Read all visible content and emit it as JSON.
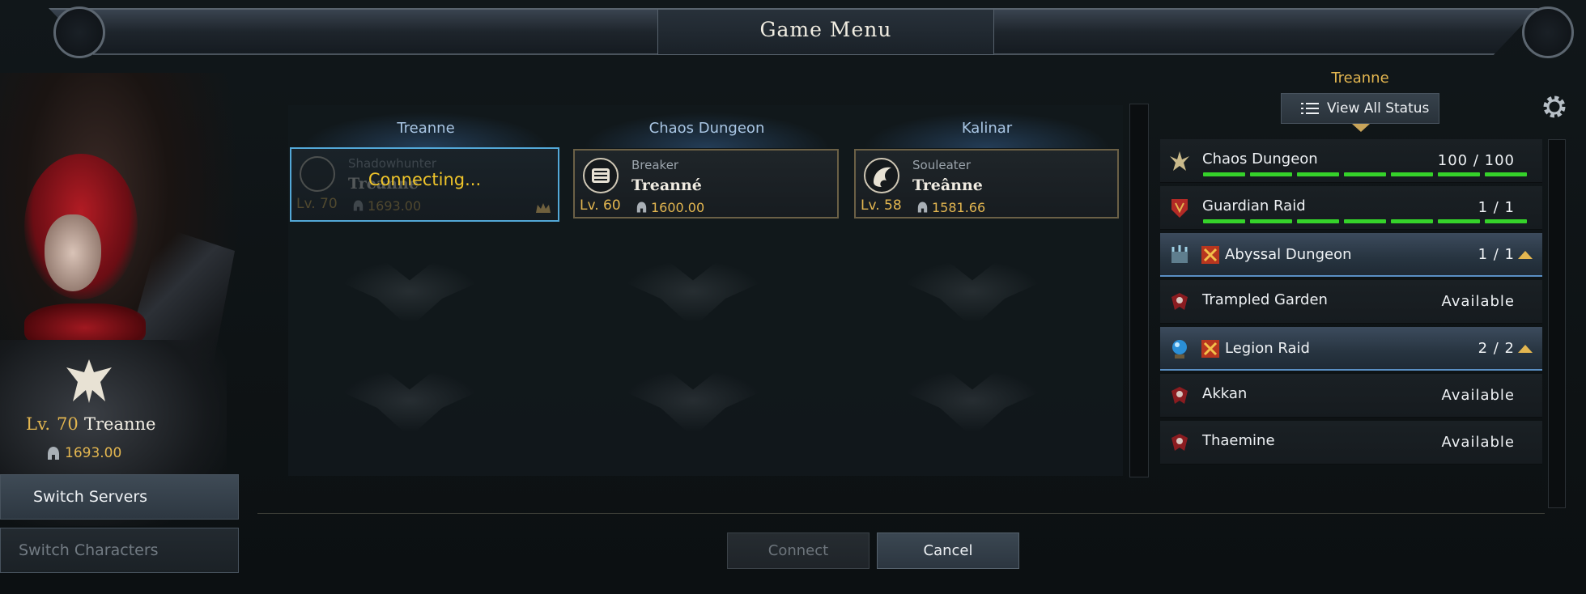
{
  "window": {
    "title": "Game Menu"
  },
  "character": {
    "level_label": "Lv.",
    "level": "70",
    "name": "Treanne",
    "item_level": "1693.00"
  },
  "side_buttons": {
    "switch_servers": "Switch Servers",
    "switch_characters": "Switch Characters"
  },
  "columns": [
    {
      "header": "Treanne"
    },
    {
      "header": "Chaos Dungeon"
    },
    {
      "header": "Kalinar"
    }
  ],
  "cards": [
    {
      "class": "Shadowhunter",
      "name": "Treanne",
      "level": "Lv. 70",
      "item_level": "1693.00",
      "status": "Connecting..."
    },
    {
      "class": "Breaker",
      "name": "Treanné",
      "level": "Lv. 60",
      "item_level": "1600.00"
    },
    {
      "class": "Souleater",
      "name": "Treânne",
      "level": "Lv. 58",
      "item_level": "1581.66"
    }
  ],
  "status_panel": {
    "character": "Treanne",
    "view_all_label": "View All Status",
    "rows": [
      {
        "label": "Chaos Dungeon",
        "value": "100 / 100",
        "progress": 1.0
      },
      {
        "label": "Guardian Raid",
        "value": "1  /  1",
        "progress": 1.0
      },
      {
        "label": "Abyssal Dungeon",
        "value": "1  /  1",
        "expanded": true
      },
      {
        "label": "Trampled Garden",
        "value": "Available"
      },
      {
        "label": "Legion Raid",
        "value": "2  /  2",
        "expanded": true
      },
      {
        "label": "Akkan",
        "value": "Available"
      },
      {
        "label": "Thaemine",
        "value": "Available"
      }
    ]
  },
  "footer": {
    "connect_label": "Connect",
    "cancel_label": "Cancel"
  },
  "colors": {
    "accent_gold": "#e3b650",
    "progress_green": "#35d22a",
    "selected_border": "#53a8d8"
  }
}
